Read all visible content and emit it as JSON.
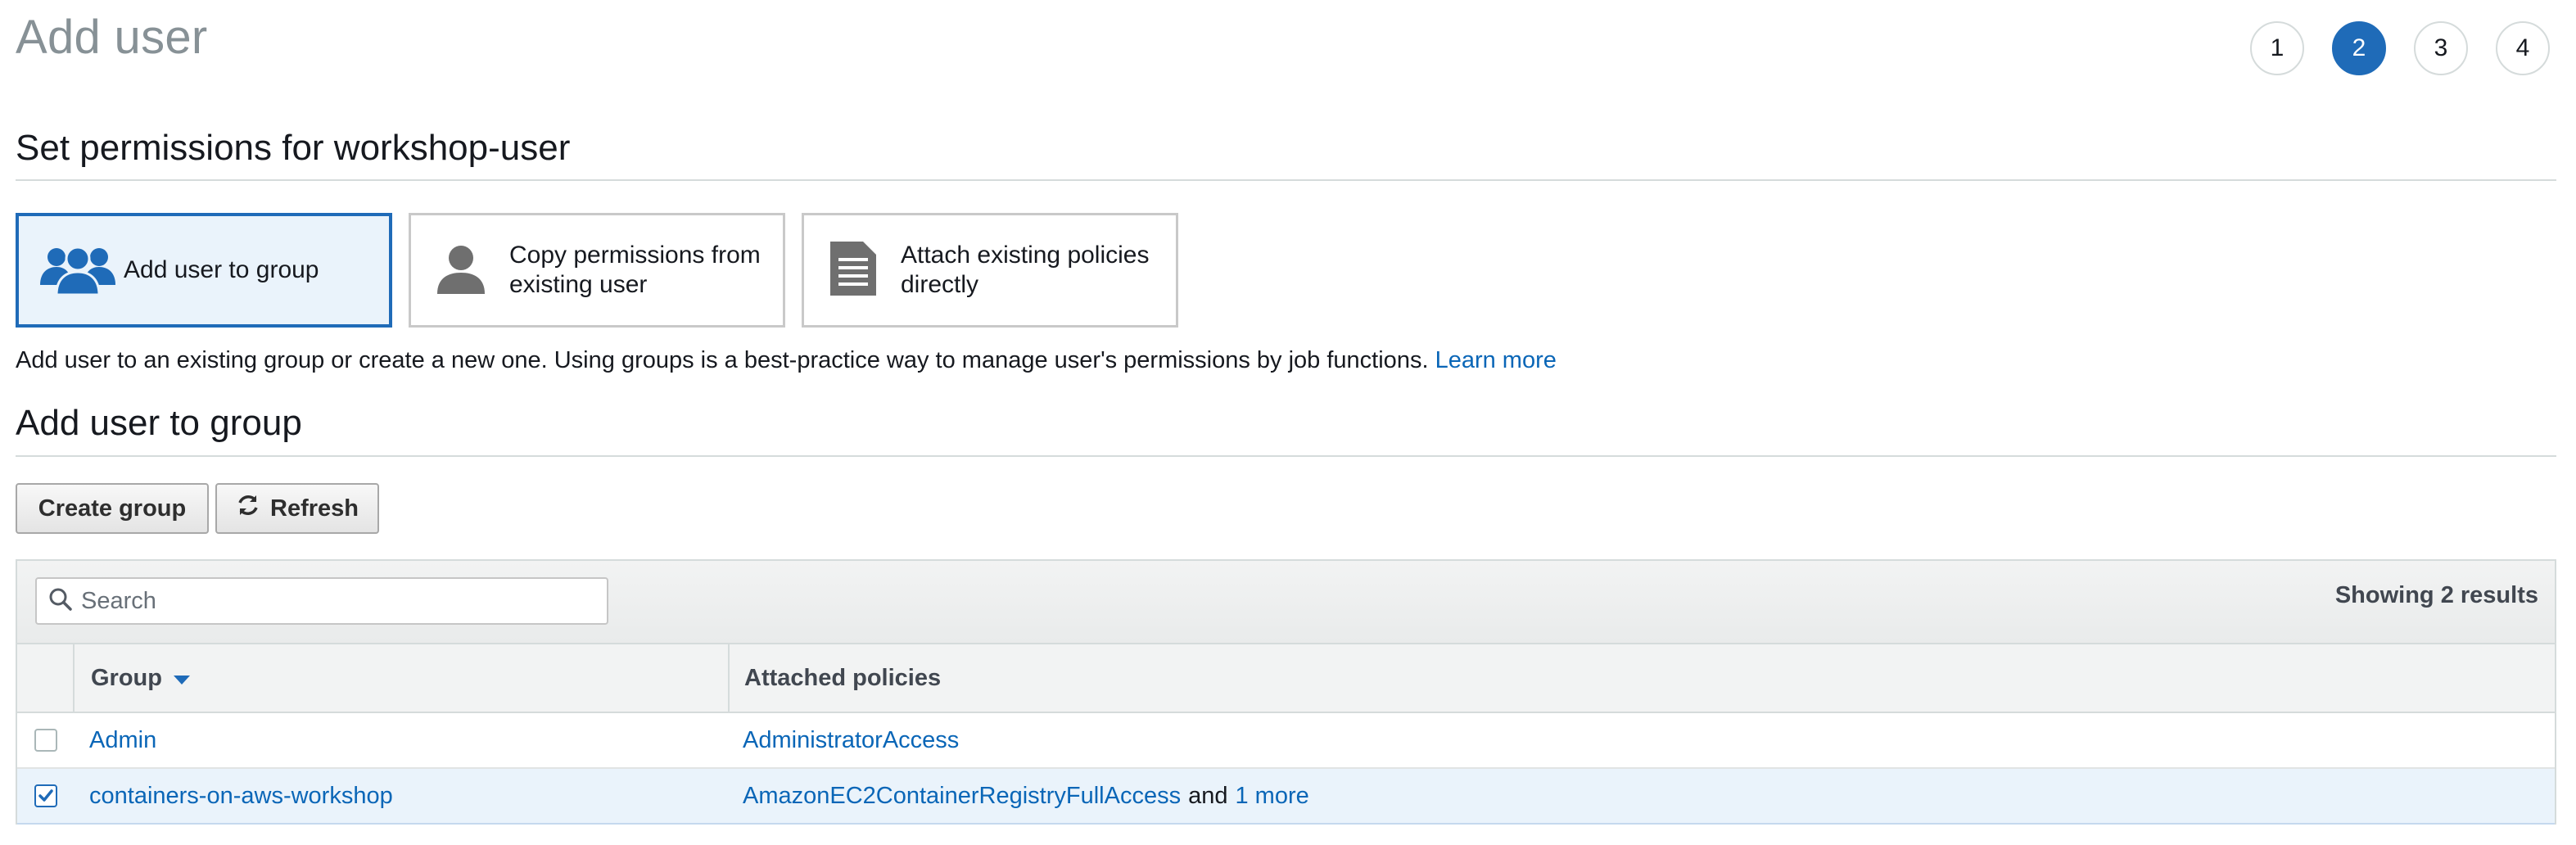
{
  "header": {
    "title": "Add user",
    "steps": [
      "1",
      "2",
      "3",
      "4"
    ],
    "active_step": "2"
  },
  "permissions": {
    "heading": "Set permissions for workshop-user",
    "options": [
      {
        "label": "Add user to group",
        "icon": "users-group-icon",
        "selected": true
      },
      {
        "label": "Copy permissions from existing user",
        "icon": "user-icon",
        "selected": false
      },
      {
        "label": "Attach existing policies directly",
        "icon": "document-icon",
        "selected": false
      }
    ],
    "description": "Add user to an existing group or create a new one. Using groups is a best-practice way to manage user's permissions by job functions.",
    "learn_more": "Learn more"
  },
  "group_section": {
    "heading": "Add user to group",
    "create_group_label": "Create group",
    "refresh_label": "Refresh"
  },
  "table": {
    "search_placeholder": "Search",
    "results_text": "Showing 2 results",
    "columns": {
      "group": "Group",
      "policies": "Attached policies"
    },
    "rows": [
      {
        "group": "Admin",
        "policy": "AdministratorAccess",
        "connector": "",
        "more": "",
        "checked": false
      },
      {
        "group": "containers-on-aws-workshop",
        "policy": "AmazonEC2ContainerRegistryFullAccess",
        "connector": "and",
        "more": "1 more",
        "checked": true
      }
    ]
  },
  "colors": {
    "accent": "#1f6bb8",
    "link": "#0a66b7",
    "selected_bg": "#eaf3fb",
    "muted_title": "#879196"
  }
}
